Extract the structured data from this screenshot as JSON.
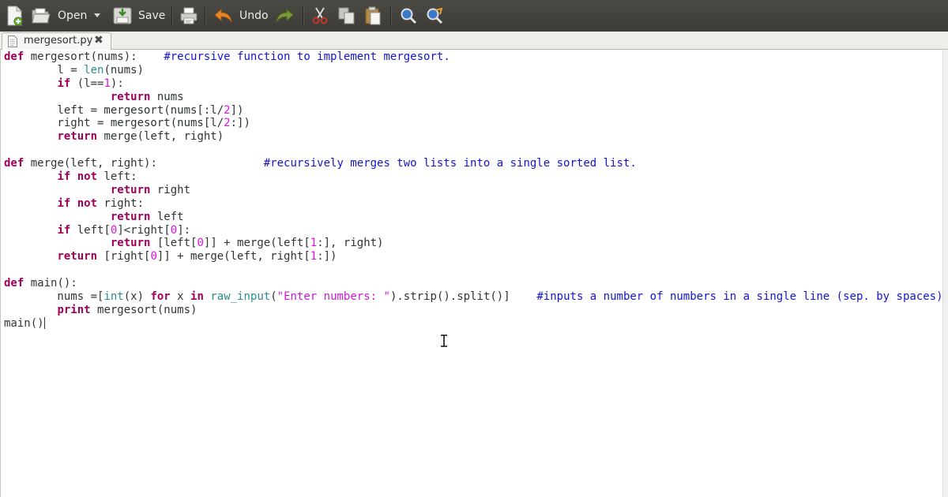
{
  "toolbar": {
    "open_label": "Open",
    "save_label": "Save",
    "undo_label": "Undo"
  },
  "tab": {
    "filename": "mergesort.py",
    "close_glyph": "✖"
  },
  "editor": {
    "lines": [
      [
        {
          "t": "def",
          "c": "kw"
        },
        {
          "t": " mergesort(nums):    ",
          "c": ""
        },
        {
          "t": "#recursive function to implement mergesort.",
          "c": "cm"
        }
      ],
      [
        {
          "t": "        l = ",
          "c": ""
        },
        {
          "t": "len",
          "c": "bi"
        },
        {
          "t": "(nums)",
          "c": ""
        }
      ],
      [
        {
          "t": "        ",
          "c": ""
        },
        {
          "t": "if",
          "c": "kw"
        },
        {
          "t": " (l==",
          "c": ""
        },
        {
          "t": "1",
          "c": "num"
        },
        {
          "t": "):",
          "c": ""
        }
      ],
      [
        {
          "t": "                ",
          "c": ""
        },
        {
          "t": "return",
          "c": "kw"
        },
        {
          "t": " nums",
          "c": ""
        }
      ],
      [
        {
          "t": "        left = mergesort(nums[:l/",
          "c": ""
        },
        {
          "t": "2",
          "c": "num"
        },
        {
          "t": "])",
          "c": ""
        }
      ],
      [
        {
          "t": "        right = mergesort(nums[l/",
          "c": ""
        },
        {
          "t": "2",
          "c": "num"
        },
        {
          "t": ":])",
          "c": ""
        }
      ],
      [
        {
          "t": "        ",
          "c": ""
        },
        {
          "t": "return",
          "c": "kw"
        },
        {
          "t": " merge(left, right)",
          "c": ""
        }
      ],
      [],
      [
        {
          "t": "def",
          "c": "kw"
        },
        {
          "t": " merge(left, right):                ",
          "c": ""
        },
        {
          "t": "#recursively merges two lists into a single sorted list.",
          "c": "cm"
        }
      ],
      [
        {
          "t": "        ",
          "c": ""
        },
        {
          "t": "if not",
          "c": "kw"
        },
        {
          "t": " left:",
          "c": ""
        }
      ],
      [
        {
          "t": "                ",
          "c": ""
        },
        {
          "t": "return",
          "c": "kw"
        },
        {
          "t": " right",
          "c": ""
        }
      ],
      [
        {
          "t": "        ",
          "c": ""
        },
        {
          "t": "if not",
          "c": "kw"
        },
        {
          "t": " right:",
          "c": ""
        }
      ],
      [
        {
          "t": "                ",
          "c": ""
        },
        {
          "t": "return",
          "c": "kw"
        },
        {
          "t": " left",
          "c": ""
        }
      ],
      [
        {
          "t": "        ",
          "c": ""
        },
        {
          "t": "if",
          "c": "kw"
        },
        {
          "t": " left[",
          "c": ""
        },
        {
          "t": "0",
          "c": "num"
        },
        {
          "t": "]<right[",
          "c": ""
        },
        {
          "t": "0",
          "c": "num"
        },
        {
          "t": "]:",
          "c": ""
        }
      ],
      [
        {
          "t": "                ",
          "c": ""
        },
        {
          "t": "return",
          "c": "kw"
        },
        {
          "t": " [left[",
          "c": ""
        },
        {
          "t": "0",
          "c": "num"
        },
        {
          "t": "]] + merge(left[",
          "c": ""
        },
        {
          "t": "1",
          "c": "num"
        },
        {
          "t": ":], right)",
          "c": ""
        }
      ],
      [
        {
          "t": "        ",
          "c": ""
        },
        {
          "t": "return",
          "c": "kw"
        },
        {
          "t": " [right[",
          "c": ""
        },
        {
          "t": "0",
          "c": "num"
        },
        {
          "t": "]] + merge(left, right[",
          "c": ""
        },
        {
          "t": "1",
          "c": "num"
        },
        {
          "t": ":])",
          "c": ""
        }
      ],
      [],
      [
        {
          "t": "def",
          "c": "kw"
        },
        {
          "t": " main():",
          "c": ""
        }
      ],
      [
        {
          "t": "        nums =[",
          "c": ""
        },
        {
          "t": "int",
          "c": "bi"
        },
        {
          "t": "(x) ",
          "c": ""
        },
        {
          "t": "for",
          "c": "kw"
        },
        {
          "t": " x ",
          "c": ""
        },
        {
          "t": "in",
          "c": "kw"
        },
        {
          "t": " ",
          "c": ""
        },
        {
          "t": "raw_input",
          "c": "bi"
        },
        {
          "t": "(",
          "c": ""
        },
        {
          "t": "\"Enter numbers: \"",
          "c": "str"
        },
        {
          "t": ").strip().split()]    ",
          "c": ""
        },
        {
          "t": "#inputs a number of numbers in a single line (sep. by spaces)",
          "c": "cm"
        }
      ],
      [
        {
          "t": "        ",
          "c": ""
        },
        {
          "t": "print",
          "c": "kw"
        },
        {
          "t": " mergesort(nums)",
          "c": ""
        }
      ],
      [
        {
          "t": "main()",
          "c": ""
        }
      ]
    ]
  },
  "colors": {
    "keyword": "#a0005a",
    "number": "#e011e6",
    "string": "#d018d8",
    "comment": "#1515c8",
    "builtin": "#2e8b8b"
  }
}
